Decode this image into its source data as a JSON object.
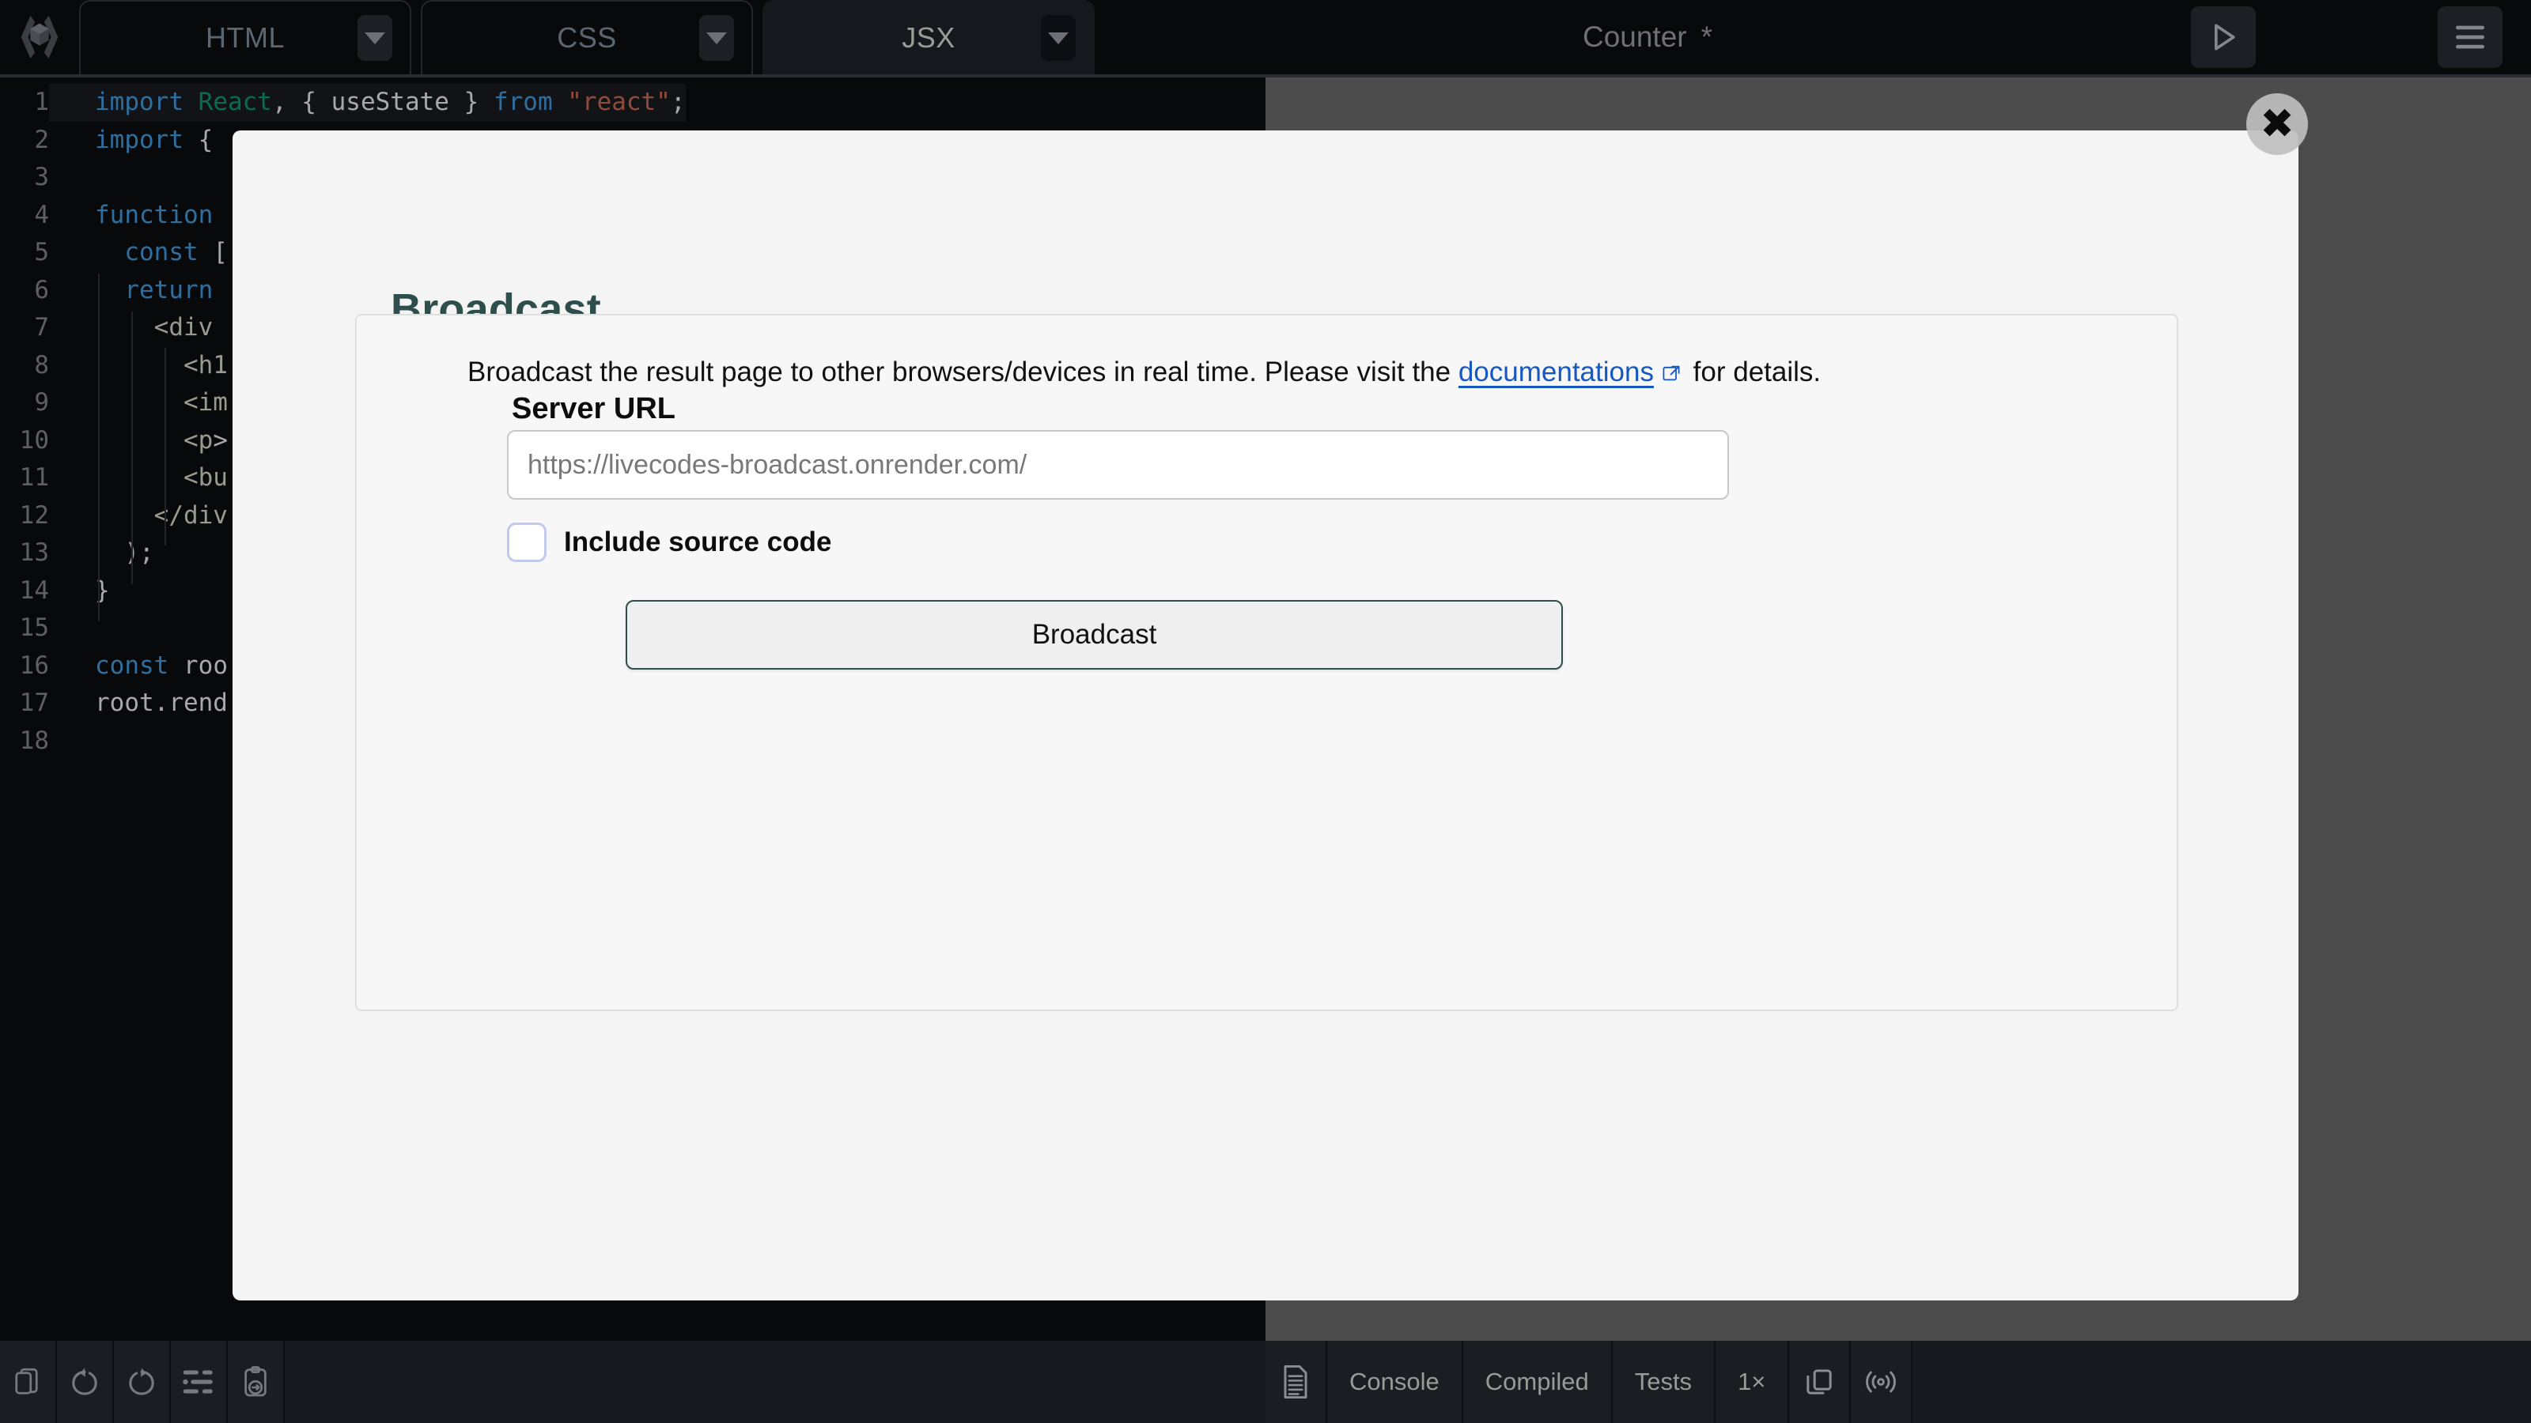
{
  "app": {
    "logo_icon": "livecodes-logo-icon",
    "project_title": "Counter",
    "unsaved_marker": "*",
    "run_icon": "play-icon",
    "menu_icon": "hamburger-menu-icon",
    "accent_color": "#2e4e4c",
    "link_color": "#1558c0"
  },
  "editor_tabs": [
    {
      "label": "HTML",
      "active": false,
      "menu_icon": "chevron-down-icon"
    },
    {
      "label": "CSS",
      "active": false,
      "menu_icon": "chevron-down-icon"
    },
    {
      "label": "JSX",
      "active": true,
      "menu_icon": "chevron-down-icon"
    }
  ],
  "code": {
    "language": "JSX",
    "lines": [
      {
        "n": "1",
        "text": "import React, { useState } from \"react\";"
      },
      {
        "n": "2",
        "text": "import {"
      },
      {
        "n": "3",
        "text": ""
      },
      {
        "n": "4",
        "text": "function"
      },
      {
        "n": "5",
        "text": "  const ["
      },
      {
        "n": "6",
        "text": "  return"
      },
      {
        "n": "7",
        "text": "    <div"
      },
      {
        "n": "8",
        "text": "      <h1"
      },
      {
        "n": "9",
        "text": "      <im"
      },
      {
        "n": "10",
        "text": "      <p>"
      },
      {
        "n": "11",
        "text": "      <bu"
      },
      {
        "n": "12",
        "text": "    </div"
      },
      {
        "n": "13",
        "text": "  );"
      },
      {
        "n": "14",
        "text": "}"
      },
      {
        "n": "15",
        "text": ""
      },
      {
        "n": "16",
        "text": "const roo"
      },
      {
        "n": "17",
        "text": "root.rend"
      },
      {
        "n": "18",
        "text": ""
      }
    ]
  },
  "modal": {
    "title": "Broadcast",
    "close_icon": "close-icon",
    "description_before_link": "Broadcast the result page to other browsers/devices in real time. Please visit the ",
    "link_text": "documentations",
    "link_icon": "external-link-icon",
    "description_after_link": " for details.",
    "server_url_label": "Server URL",
    "server_url_value": "",
    "server_url_placeholder": "https://livecodes-broadcast.onrender.com/",
    "include_source_label": "Include source code",
    "include_source_checked": false,
    "submit_label": "Broadcast"
  },
  "editor_statusbar": {
    "buttons": [
      {
        "icon": "copy-icon",
        "label": "Copy"
      },
      {
        "icon": "undo-icon",
        "label": "Undo"
      },
      {
        "icon": "redo-icon",
        "label": "Redo"
      },
      {
        "icon": "format-icon",
        "label": "Format"
      },
      {
        "icon": "clipboard-link-icon",
        "label": "Copy as link"
      }
    ]
  },
  "result_statusbar": {
    "doc_icon": "document-icon",
    "tabs": [
      {
        "label": "Console"
      },
      {
        "label": "Compiled"
      },
      {
        "label": "Tests"
      }
    ],
    "zoom_label": "1×",
    "external_icon": "open-in-new-window-icon",
    "broadcast_icon": "broadcast-signal-icon"
  }
}
